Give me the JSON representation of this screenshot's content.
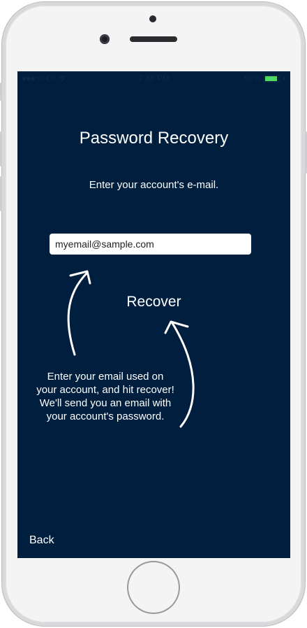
{
  "status_bar": {
    "signal": "●●●○○",
    "carrier": "O!",
    "wifi_icon": "wifi-icon",
    "time": "7:48 PM",
    "battery_pct": "96%",
    "battery_level": 0.96,
    "battery_color": "#4cd964"
  },
  "screen": {
    "title": "Password Recovery",
    "subtitle": "Enter your account's e-mail.",
    "email_value": "myemail@sample.com",
    "recover_label": "Recover",
    "annotation": "Enter your email used on your account, and hit recover! We'll send you an email with your account's password.",
    "back_label": "Back",
    "background": "#001f3f"
  }
}
